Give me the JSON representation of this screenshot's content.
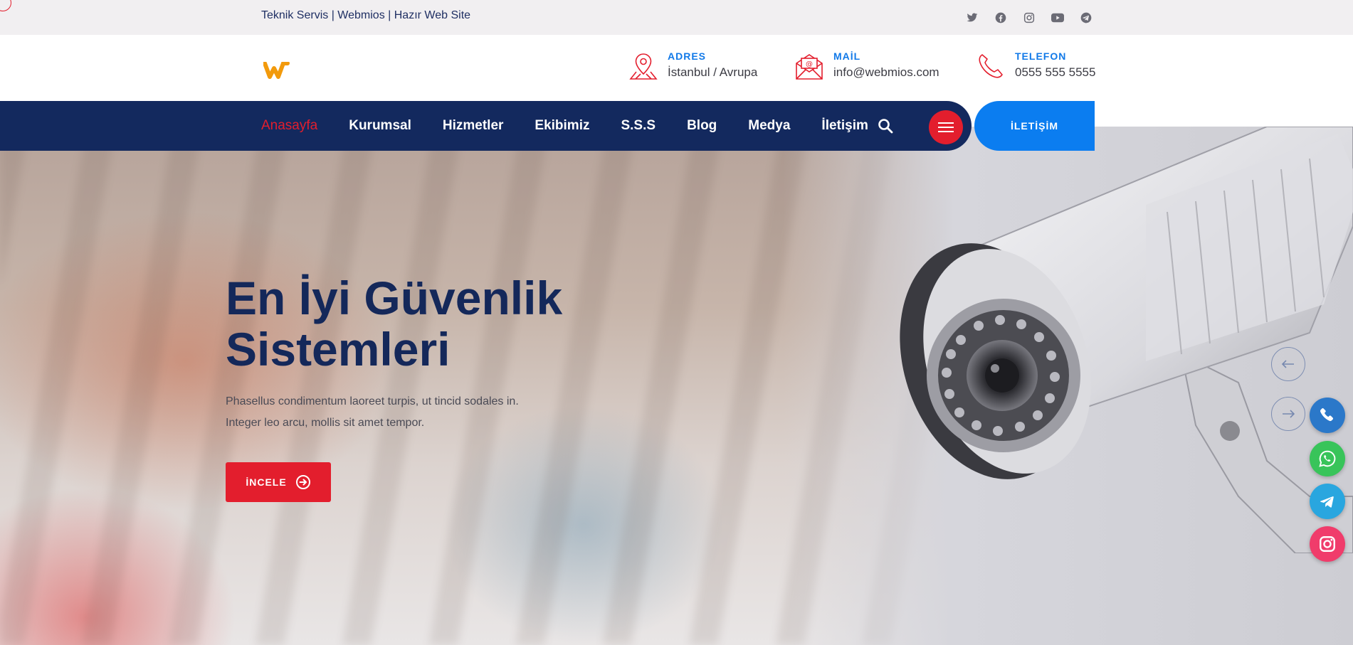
{
  "topbar": {
    "tagline": "Teknik Servis | Webmios | Hazır Web Site",
    "socials": [
      "twitter-icon",
      "facebook-icon",
      "instagram-icon",
      "youtube-icon",
      "telegram-icon"
    ]
  },
  "header": {
    "logo_text": "w",
    "contacts": [
      {
        "title": "ADRES",
        "value": "İstanbul / Avrupa",
        "icon": "map-pin-icon"
      },
      {
        "title": "MAİL",
        "value": "info@webmios.com",
        "icon": "mail-icon"
      },
      {
        "title": "TELEFON",
        "value": "0555 555 5555",
        "icon": "phone-icon"
      }
    ]
  },
  "nav": {
    "items": [
      "Anasayfa",
      "Kurumsal",
      "Hizmetler",
      "Ekibimiz",
      "S.S.S",
      "Blog",
      "Medya",
      "İletişim"
    ],
    "active_index": 0,
    "cta_label": "İLETİŞİM"
  },
  "hero": {
    "title": "En İyi Güvenlik Sistemleri",
    "description": "Phasellus condimentum laoreet turpis, ut tincid sodales in. Integer leo arcu, mollis sit amet tempor.",
    "button_label": "İNCELE"
  },
  "colors": {
    "navy": "#13295e",
    "red": "#e31e2d",
    "blue": "#0b7df0",
    "logo_orange": "#f29a0c"
  },
  "floating": [
    "phone-icon",
    "whatsapp-icon",
    "telegram-icon",
    "instagram-icon"
  ]
}
